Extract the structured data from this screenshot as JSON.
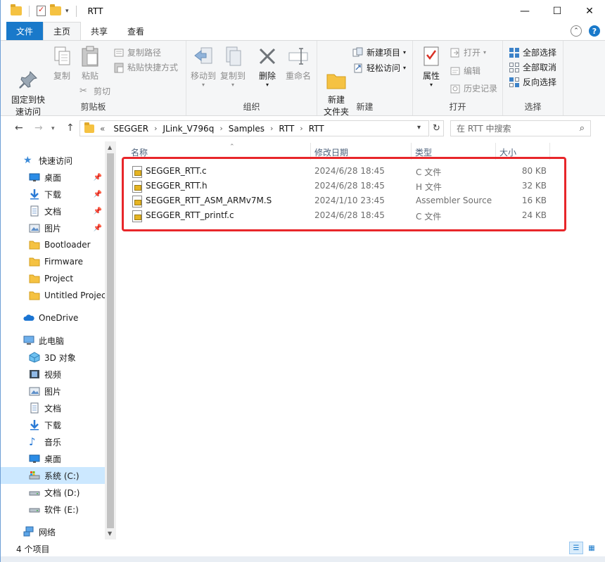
{
  "window": {
    "title": "RTT",
    "controls": {
      "minimize": "—",
      "maximize": "☐",
      "close": "✕"
    }
  },
  "ribbon_tabs": {
    "file": "文件",
    "home": "主页",
    "share": "共享",
    "view": "查看"
  },
  "ribbon": {
    "clipboard": {
      "label": "剪贴板",
      "pin": "固定到快\n速访问",
      "copy": "复制",
      "paste": "粘贴",
      "copy_path": "复制路径",
      "paste_shortcut": "粘贴快捷方式",
      "cut": "剪切"
    },
    "organize": {
      "label": "组织",
      "move_to": "移动到",
      "copy_to": "复制到",
      "delete": "删除",
      "rename": "重命名"
    },
    "new": {
      "label": "新建",
      "new_folder": "新建\n文件夹",
      "new_item": "新建项目",
      "easy_access": "轻松访问"
    },
    "open": {
      "label": "打开",
      "properties": "属性",
      "open": "打开",
      "edit": "编辑",
      "history": "历史记录"
    },
    "select": {
      "label": "选择",
      "select_all": "全部选择",
      "select_none": "全部取消",
      "invert": "反向选择"
    }
  },
  "address": {
    "overflow": "«",
    "crumbs": [
      "SEGGER",
      "JLink_V796q",
      "Samples",
      "RTT",
      "RTT"
    ],
    "search_placeholder": "在 RTT 中搜索"
  },
  "nav": {
    "quick_access": "快速访问",
    "items_quick": [
      {
        "label": "桌面",
        "icon": "desktop-icon",
        "pinned": true
      },
      {
        "label": "下载",
        "icon": "download-icon",
        "pinned": true
      },
      {
        "label": "文档",
        "icon": "documents-icon",
        "pinned": true
      },
      {
        "label": "图片",
        "icon": "pictures-icon",
        "pinned": true
      },
      {
        "label": "Bootloader",
        "icon": "folder-icon",
        "pinned": false
      },
      {
        "label": "Firmware",
        "icon": "folder-icon",
        "pinned": false
      },
      {
        "label": "Project",
        "icon": "folder-icon",
        "pinned": false
      },
      {
        "label": "Untitled Project",
        "icon": "folder-icon",
        "pinned": false
      }
    ],
    "onedrive": "OneDrive",
    "this_pc": "此电脑",
    "items_pc": [
      {
        "label": "3D 对象",
        "icon": "3d-objects-icon"
      },
      {
        "label": "视频",
        "icon": "videos-icon"
      },
      {
        "label": "图片",
        "icon": "pictures-icon"
      },
      {
        "label": "文档",
        "icon": "documents-icon"
      },
      {
        "label": "下载",
        "icon": "download-icon"
      },
      {
        "label": "音乐",
        "icon": "music-icon"
      },
      {
        "label": "桌面",
        "icon": "desktop-icon"
      },
      {
        "label": "系统 (C:)",
        "icon": "drive-c-icon",
        "selected": true
      },
      {
        "label": "文档 (D:)",
        "icon": "drive-icon"
      },
      {
        "label": "软件 (E:)",
        "icon": "drive-icon"
      }
    ],
    "network": "网络"
  },
  "file_list": {
    "columns": {
      "name": "名称",
      "date": "修改日期",
      "type": "类型",
      "size": "大小"
    },
    "files": [
      {
        "name": "SEGGER_RTT.c",
        "date": "2024/6/28 18:45",
        "type": "C 文件",
        "size": "80 KB"
      },
      {
        "name": "SEGGER_RTT.h",
        "date": "2024/6/28 18:45",
        "type": "H 文件",
        "size": "32 KB"
      },
      {
        "name": "SEGGER_RTT_ASM_ARMv7M.S",
        "date": "2024/1/10 23:45",
        "type": "Assembler Source",
        "size": "16 KB"
      },
      {
        "name": "SEGGER_RTT_printf.c",
        "date": "2024/6/28 18:45",
        "type": "C 文件",
        "size": "24 KB"
      }
    ],
    "highlight_color": "#e8262a"
  },
  "status": {
    "count": "4 个项目"
  },
  "colors": {
    "accent": "#1979ca",
    "selection": "#cce8ff",
    "folder": "#f5c242"
  }
}
